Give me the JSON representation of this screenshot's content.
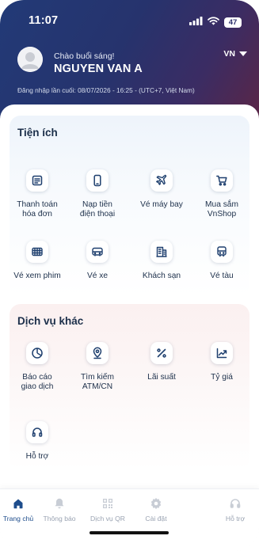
{
  "status_bar": {
    "time": "11:07",
    "battery": "47",
    "icons": [
      "signal-icon",
      "wifi-icon",
      "battery-icon"
    ]
  },
  "profile": {
    "greeting": "Chào buổi sáng!",
    "name": "NGUYEN VAN A",
    "language": "VN",
    "last_login": "Đăng nhập lần cuối: 08/07/2026 - 16:25 - (UTC+7, Việt Nam)"
  },
  "utilities": {
    "title": "Tiện ích",
    "items": [
      {
        "line1": "Thanh toán",
        "line2": "hóa đơn",
        "icon": "bill-icon"
      },
      {
        "line1": "Nạp tiền",
        "line2": "điện thoại",
        "icon": "phone-icon"
      },
      {
        "line1": "Vé máy bay",
        "line2": "",
        "icon": "plane-icon"
      },
      {
        "line1": "Mua sắm",
        "line2": "VnShop",
        "icon": "cart-icon"
      },
      {
        "line1": "Vé xem phim",
        "line2": "",
        "icon": "cinema-icon"
      },
      {
        "line1": "Vé xe",
        "line2": "",
        "icon": "bus-icon"
      },
      {
        "line1": "Khách sạn",
        "line2": "",
        "icon": "hotel-icon"
      },
      {
        "line1": "Vé tàu",
        "line2": "",
        "icon": "train-icon"
      }
    ]
  },
  "other_services": {
    "title": "Dịch vụ khác",
    "items": [
      {
        "line1": "Báo cáo",
        "line2": "giao dịch",
        "icon": "pie-chart-icon"
      },
      {
        "line1": "Tìm kiếm",
        "line2": "ATM/CN",
        "icon": "location-pin-icon"
      },
      {
        "line1": "Lãi suất",
        "line2": "",
        "icon": "percent-icon"
      },
      {
        "line1": "Tỷ giá",
        "line2": "",
        "icon": "trend-chart-icon"
      },
      {
        "line1": "Hỗ trợ",
        "line2": "",
        "icon": "headset-icon"
      }
    ]
  },
  "bottom_nav": {
    "items": [
      {
        "label": "Trang chủ",
        "icon": "home-icon",
        "active": true
      },
      {
        "label": "Thông báo",
        "icon": "bell-icon",
        "active": false
      },
      {
        "label": "Dịch vụ QR",
        "icon": "qr-icon",
        "active": false
      },
      {
        "label": "Cài đặt",
        "icon": "gear-icon",
        "active": false
      },
      {
        "label": "Hỗ trợ",
        "icon": "headset-icon",
        "active": false
      }
    ]
  },
  "colors": {
    "header_gradient": [
      "#223a77",
      "#5a2647"
    ],
    "text_dark": "#1c2f4a",
    "icon_blue": "#1e3f6e",
    "nav_active": "#1e4d8c",
    "nav_inactive": "#9aa3b2"
  }
}
